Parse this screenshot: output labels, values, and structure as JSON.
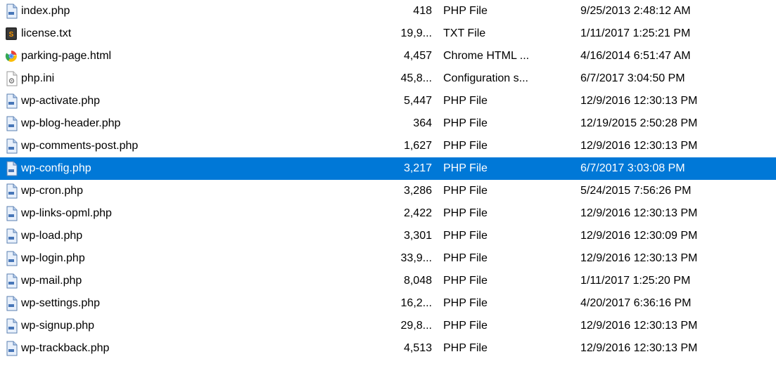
{
  "files": [
    {
      "icon": "php",
      "name": "index.php",
      "size": "418",
      "type": "PHP File",
      "date": "9/25/2013 2:48:12 AM",
      "selected": false
    },
    {
      "icon": "txt",
      "name": "license.txt",
      "size": "19,9...",
      "type": "TXT File",
      "date": "1/11/2017 1:25:21 PM",
      "selected": false
    },
    {
      "icon": "chrome",
      "name": "parking-page.html",
      "size": "4,457",
      "type": "Chrome HTML ...",
      "date": "4/16/2014 6:51:47 AM",
      "selected": false
    },
    {
      "icon": "ini",
      "name": "php.ini",
      "size": "45,8...",
      "type": "Configuration s...",
      "date": "6/7/2017 3:04:50 PM",
      "selected": false
    },
    {
      "icon": "php",
      "name": "wp-activate.php",
      "size": "5,447",
      "type": "PHP File",
      "date": "12/9/2016 12:30:13 PM",
      "selected": false
    },
    {
      "icon": "php",
      "name": "wp-blog-header.php",
      "size": "364",
      "type": "PHP File",
      "date": "12/19/2015 2:50:28 PM",
      "selected": false
    },
    {
      "icon": "php",
      "name": "wp-comments-post.php",
      "size": "1,627",
      "type": "PHP File",
      "date": "12/9/2016 12:30:13 PM",
      "selected": false
    },
    {
      "icon": "php",
      "name": "wp-config.php",
      "size": "3,217",
      "type": "PHP File",
      "date": "6/7/2017 3:03:08 PM",
      "selected": true
    },
    {
      "icon": "php",
      "name": "wp-cron.php",
      "size": "3,286",
      "type": "PHP File",
      "date": "5/24/2015 7:56:26 PM",
      "selected": false
    },
    {
      "icon": "php",
      "name": "wp-links-opml.php",
      "size": "2,422",
      "type": "PHP File",
      "date": "12/9/2016 12:30:13 PM",
      "selected": false
    },
    {
      "icon": "php",
      "name": "wp-load.php",
      "size": "3,301",
      "type": "PHP File",
      "date": "12/9/2016 12:30:09 PM",
      "selected": false
    },
    {
      "icon": "php",
      "name": "wp-login.php",
      "size": "33,9...",
      "type": "PHP File",
      "date": "12/9/2016 12:30:13 PM",
      "selected": false
    },
    {
      "icon": "php",
      "name": "wp-mail.php",
      "size": "8,048",
      "type": "PHP File",
      "date": "1/11/2017 1:25:20 PM",
      "selected": false
    },
    {
      "icon": "php",
      "name": "wp-settings.php",
      "size": "16,2...",
      "type": "PHP File",
      "date": "4/20/2017 6:36:16 PM",
      "selected": false
    },
    {
      "icon": "php",
      "name": "wp-signup.php",
      "size": "29,8...",
      "type": "PHP File",
      "date": "12/9/2016 12:30:13 PM",
      "selected": false
    },
    {
      "icon": "php",
      "name": "wp-trackback.php",
      "size": "4,513",
      "type": "PHP File",
      "date": "12/9/2016 12:30:13 PM",
      "selected": false
    }
  ]
}
